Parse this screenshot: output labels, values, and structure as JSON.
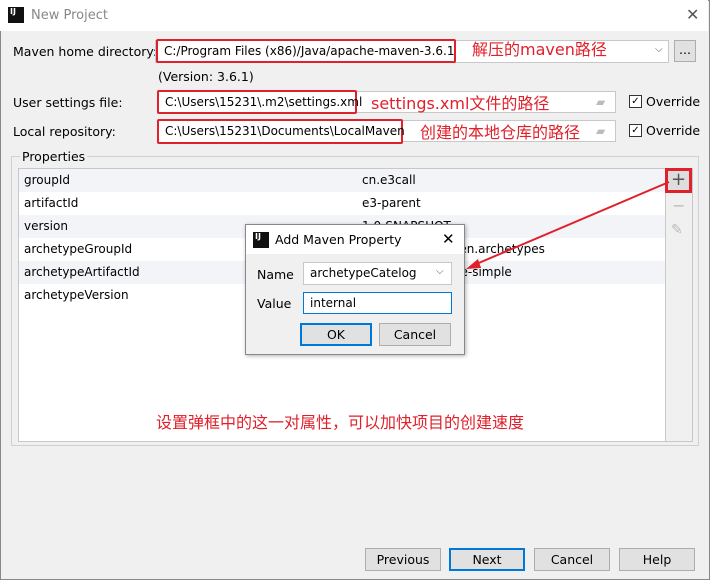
{
  "window": {
    "title": "New Project",
    "close_icon": "close-icon"
  },
  "form": {
    "maven_home_label": "Maven home directory:",
    "maven_home_value": "C:/Program Files (x86)/Java/apache-maven-3.6.1",
    "version_text": "(Version: 3.6.1)",
    "user_settings_label": "User settings file:",
    "user_settings_value": "C:\\Users\\15231\\.m2\\settings.xml",
    "local_repo_label": "Local repository:",
    "local_repo_value": "C:\\Users\\15231\\Documents\\LocalMaven",
    "override_label": "Override",
    "browse_label": "..."
  },
  "annotations": {
    "maven_home": "解压的maven路径",
    "settings": "settings.xml文件的路径",
    "local_repo": "创建的本地仓库的路径",
    "dialog_note": "设置弹框中的这一对属性，可以加快项目的创建速度",
    "color": "#e0202a"
  },
  "properties": {
    "group_label": "Properties",
    "rows": [
      {
        "key": "groupId",
        "value": "cn.e3call"
      },
      {
        "key": "artifactId",
        "value": "e3-parent"
      },
      {
        "key": "version",
        "value": "1.0-SNAPSHOT"
      },
      {
        "key": "archetypeGroupId",
        "value": "org.apache.maven.archetypes"
      },
      {
        "key": "archetypeArtifactId",
        "value": "maven-archetype-simple"
      },
      {
        "key": "archetypeVersion",
        "value": ""
      }
    ]
  },
  "dialog": {
    "title": "Add Maven Property",
    "name_label": "Name",
    "name_value": "archetypeCatelog",
    "value_label": "Value",
    "value_value": "internal",
    "ok": "OK",
    "cancel": "Cancel"
  },
  "footer": {
    "previous": "Previous",
    "next": "Next",
    "cancel": "Cancel",
    "help": "Help"
  },
  "colors": {
    "accent": "#0078d7"
  }
}
